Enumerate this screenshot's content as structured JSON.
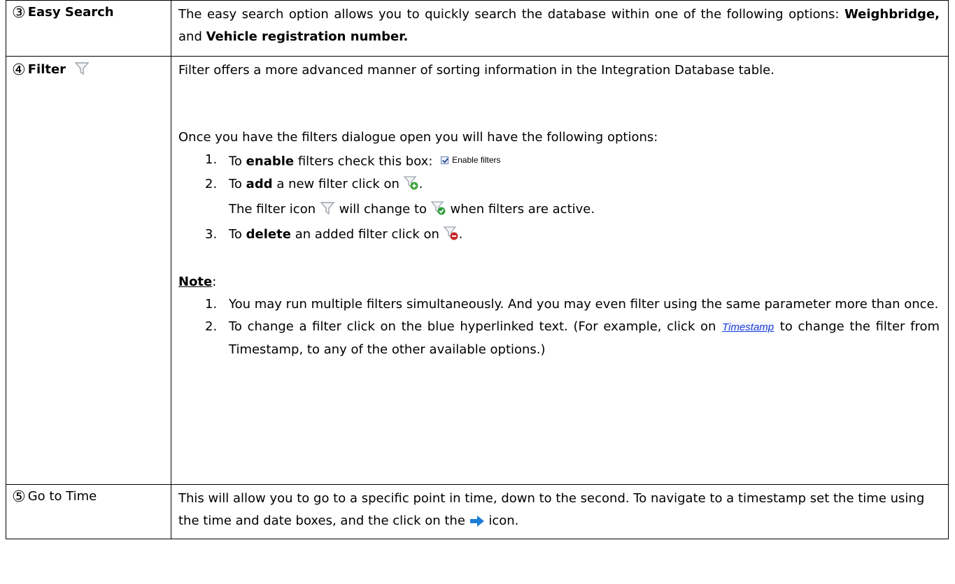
{
  "rows": [
    {
      "num": "③",
      "label": "Easy Search",
      "text_a": "The easy search option allows you to quickly search the database within one of the following options: ",
      "bold_a": "Weighbridge,",
      "text_b": " and ",
      "bold_b": "Vehicle registration number."
    },
    {
      "num": "④",
      "label": "Filter",
      "intro": "Filter offers a more advanced manner of sorting information in the Integration Database table.",
      "dialogue": "Once you have the filters dialogue open you will have the following options:",
      "steps": [
        {
          "num": "1.",
          "pre": "To ",
          "bold": "enable",
          "post": " filters check this box:",
          "control_label": "Enable filters"
        },
        {
          "num": "2.",
          "pre": "To ",
          "bold": "add",
          "post": " a new filter click on ",
          "end": "."
        },
        {
          "num": "3.",
          "pre": "To ",
          "bold": "delete",
          "post": " an added filter click on ",
          "end": "."
        }
      ],
      "filter_change_a": "The filter icon ",
      "filter_change_b": " will change to ",
      "filter_change_c": " when filters are active.",
      "note_heading": "Note",
      "note_colon": ":",
      "notes": [
        {
          "num": "1.",
          "text": "You may run multiple filters simultaneously. And you may even filter using the same parameter more than once."
        },
        {
          "num": "2.",
          "pre": "To change a filter click on the blue hyperlinked text. (For example, click on ",
          "link": "Timestamp",
          "post": " to change the filter from Timestamp, to any of the other available options.)"
        }
      ]
    },
    {
      "num": "⑤",
      "label": "Go to Time",
      "text_a": "This will allow you to go to a specific point in time, down to the second. To navigate to a timestamp set the time using the time and date boxes, and the click on the ",
      "text_b": " icon."
    }
  ],
  "icons": {
    "filter": "filter-funnel-icon",
    "filter_add": "filter-add-icon",
    "filter_active": "filter-active-icon",
    "filter_delete": "filter-delete-icon",
    "arrow": "arrow-right-icon"
  },
  "colors": {
    "funnel": "#9aa3ab",
    "add_green": "#3aa335",
    "active_green": "#2e9e3e",
    "delete_red": "#c8262b",
    "arrow_blue": "#1c7ed6",
    "link_blue": "#1a3fd6"
  }
}
